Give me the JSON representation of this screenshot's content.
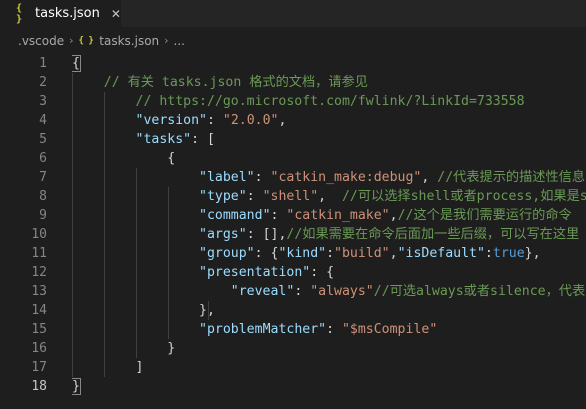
{
  "tab": {
    "icon": "{ }",
    "label": "tasks.json",
    "close": "✕"
  },
  "breadcrumb": {
    "items": [
      ".vscode",
      "tasks.json",
      "..."
    ],
    "separator": "›",
    "icon": "{ }"
  },
  "line_numbers": [
    "1",
    "2",
    "3",
    "4",
    "5",
    "6",
    "7",
    "8",
    "9",
    "10",
    "11",
    "12",
    "13",
    "14",
    "15",
    "16",
    "17",
    "18"
  ],
  "code": [
    [
      {
        "t": "{",
        "c": "punc"
      }
    ],
    [
      {
        "t": "    // 有关 tasks.json 格式的文档，请参见",
        "c": "cmt"
      }
    ],
    [
      {
        "t": "        // https://go.microsoft.com/fwlink/?LinkId=733558",
        "c": "cmt"
      }
    ],
    [
      {
        "t": "        ",
        "c": "punc"
      },
      {
        "t": "\"version\"",
        "c": "key"
      },
      {
        "t": ": ",
        "c": "punc"
      },
      {
        "t": "\"2.0.0\"",
        "c": "str"
      },
      {
        "t": ",",
        "c": "punc"
      }
    ],
    [
      {
        "t": "        ",
        "c": "punc"
      },
      {
        "t": "\"tasks\"",
        "c": "key"
      },
      {
        "t": ": [",
        "c": "punc"
      }
    ],
    [
      {
        "t": "            {",
        "c": "punc"
      }
    ],
    [
      {
        "t": "                ",
        "c": "punc"
      },
      {
        "t": "\"label\"",
        "c": "key"
      },
      {
        "t": ": ",
        "c": "punc"
      },
      {
        "t": "\"catkin_make:debug\"",
        "c": "str"
      },
      {
        "t": ", ",
        "c": "punc"
      },
      {
        "t": "//代表提示的描述性信息",
        "c": "cmt"
      }
    ],
    [
      {
        "t": "                ",
        "c": "punc"
      },
      {
        "t": "\"type\"",
        "c": "key"
      },
      {
        "t": ": ",
        "c": "punc"
      },
      {
        "t": "\"shell\"",
        "c": "str"
      },
      {
        "t": ",  ",
        "c": "punc"
      },
      {
        "t": "//可以选择shell或者process,如果是shell",
        "c": "cmt"
      }
    ],
    [
      {
        "t": "                ",
        "c": "punc"
      },
      {
        "t": "\"command\"",
        "c": "key"
      },
      {
        "t": ": ",
        "c": "punc"
      },
      {
        "t": "\"catkin_make\"",
        "c": "str"
      },
      {
        "t": ",",
        "c": "punc"
      },
      {
        "t": "//这个是我们需要运行的命令",
        "c": "cmt"
      }
    ],
    [
      {
        "t": "                ",
        "c": "punc"
      },
      {
        "t": "\"args\"",
        "c": "key"
      },
      {
        "t": ": [],",
        "c": "punc"
      },
      {
        "t": "//如果需要在命令后面加一些后缀，可以写在这里",
        "c": "cmt"
      }
    ],
    [
      {
        "t": "                ",
        "c": "punc"
      },
      {
        "t": "\"group\"",
        "c": "key"
      },
      {
        "t": ": {",
        "c": "punc"
      },
      {
        "t": "\"kind\"",
        "c": "key"
      },
      {
        "t": ":",
        "c": "punc"
      },
      {
        "t": "\"build\"",
        "c": "str"
      },
      {
        "t": ",",
        "c": "punc"
      },
      {
        "t": "\"isDefault\"",
        "c": "key"
      },
      {
        "t": ":",
        "c": "punc"
      },
      {
        "t": "true",
        "c": "kw"
      },
      {
        "t": "},",
        "c": "punc"
      }
    ],
    [
      {
        "t": "                ",
        "c": "punc"
      },
      {
        "t": "\"presentation\"",
        "c": "key"
      },
      {
        "t": ": {",
        "c": "punc"
      }
    ],
    [
      {
        "t": "                    ",
        "c": "punc"
      },
      {
        "t": "\"reveal\"",
        "c": "key"
      },
      {
        "t": ": ",
        "c": "punc"
      },
      {
        "t": "\"always\"",
        "c": "str"
      },
      {
        "t": "//可选always或者silence，代表",
        "c": "cmt"
      }
    ],
    [
      {
        "t": "                },",
        "c": "punc"
      }
    ],
    [
      {
        "t": "                ",
        "c": "punc"
      },
      {
        "t": "\"problemMatcher\"",
        "c": "key"
      },
      {
        "t": ": ",
        "c": "punc"
      },
      {
        "t": "\"$msCompile\"",
        "c": "str"
      }
    ],
    [
      {
        "t": "            }",
        "c": "punc"
      }
    ],
    [
      {
        "t": "        ]",
        "c": "punc"
      }
    ],
    [
      {
        "t": "}",
        "c": "punc"
      }
    ]
  ],
  "colors": {
    "background": "#1e1e1e",
    "key": "#9cdcfe",
    "string": "#ce9178",
    "comment": "#6a9955",
    "keyword": "#569cd6",
    "json_icon": "#cbcb41"
  }
}
